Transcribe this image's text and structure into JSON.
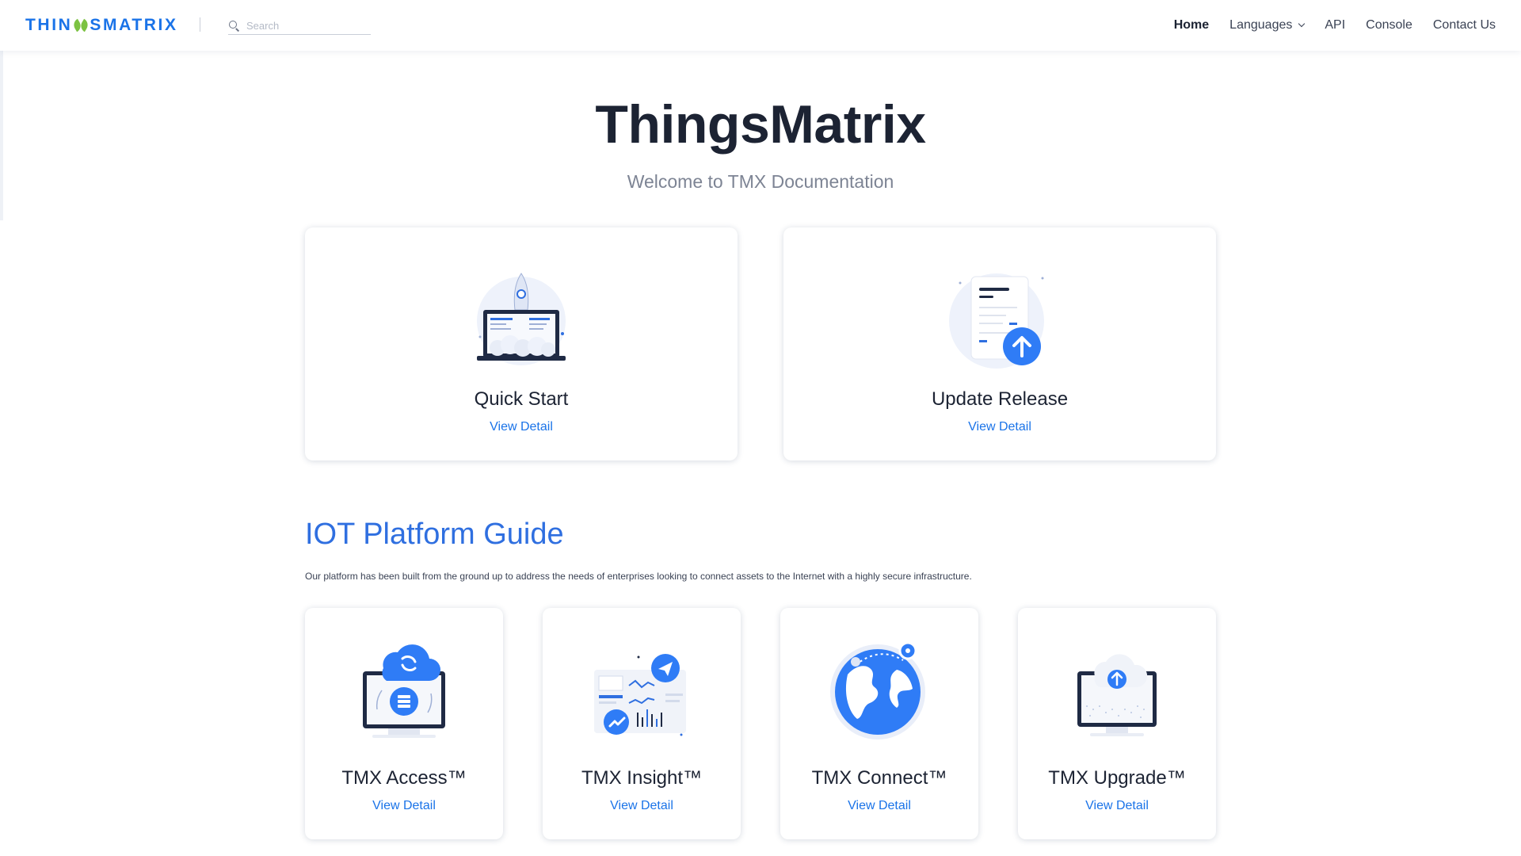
{
  "nav": {
    "logo_text": "THINGSMATRIX",
    "search_placeholder": "Search",
    "links": [
      "Home",
      "Languages",
      "API",
      "Console",
      "Contact Us"
    ]
  },
  "hero": {
    "title": "ThingsMatrix",
    "subtitle": "Welcome to TMX Documentation"
  },
  "top_cards": [
    {
      "title": "Quick Start",
      "link": "View Detail",
      "icon": "rocket-laptop-icon"
    },
    {
      "title": "Update Release",
      "link": "View Detail",
      "icon": "document-upload-icon"
    }
  ],
  "guide": {
    "title": "IOT Platform Guide",
    "description": "Our platform has been built from the ground up to address the needs of enterprises looking to connect assets to the Internet with a highly secure infrastructure.",
    "cards": [
      {
        "title": "TMX Access™",
        "link": "View Detail",
        "icon": "cloud-sync-monitor-icon"
      },
      {
        "title": "TMX Insight™",
        "link": "View Detail",
        "icon": "analytics-dashboard-icon"
      },
      {
        "title": "TMX Connect™",
        "link": "View Detail",
        "icon": "globe-location-icon"
      },
      {
        "title": "TMX Upgrade™",
        "link": "View Detail",
        "icon": "cloud-upgrade-monitor-icon"
      }
    ]
  },
  "colors": {
    "accent": "#1a73e8",
    "section_title": "#2f6fe0",
    "logo_leaf": "#7cc242"
  }
}
